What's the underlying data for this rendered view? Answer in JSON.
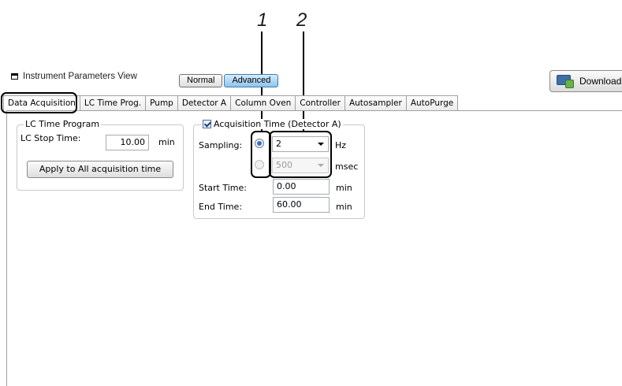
{
  "callouts": [
    "1",
    "2"
  ],
  "toolbar": {
    "title": "Instrument Parameters View",
    "mode_normal": "Normal",
    "mode_advanced": "Advanced",
    "download_label": "Download"
  },
  "tabs": [
    "Data Acquisition",
    "LC Time Prog.",
    "Pump",
    "Detector A",
    "Column Oven",
    "Controller",
    "Autosampler",
    "AutoPurge"
  ],
  "lc_time_program": {
    "title": "LC Time Program",
    "stop_time_label": "LC Stop Time:",
    "stop_time_value": "10.00",
    "stop_time_unit": "min",
    "apply_button": "Apply to All acquisition time"
  },
  "acquisition": {
    "title": "Acquisition Time (Detector A)",
    "checked": true,
    "sampling_label": "Sampling:",
    "hz_value": "2",
    "hz_unit": "Hz",
    "msec_value": "500",
    "msec_unit": "msec",
    "start_label": "Start Time:",
    "start_value": "0.00",
    "start_unit": "min",
    "end_label": "End Time:",
    "end_value": "60.00",
    "end_unit": "min"
  }
}
